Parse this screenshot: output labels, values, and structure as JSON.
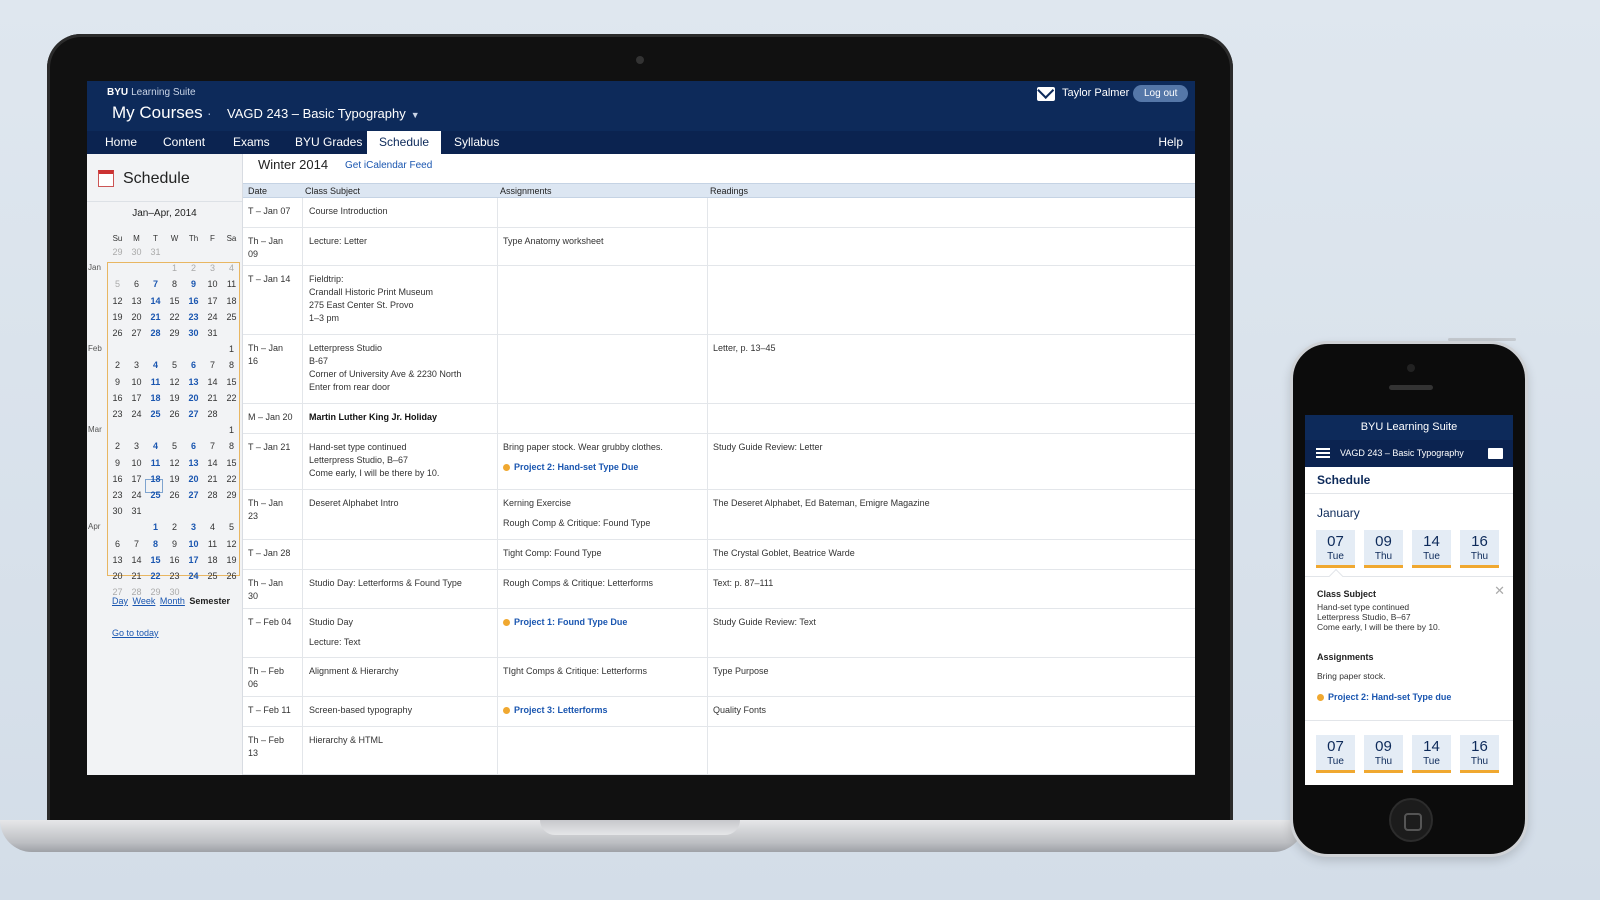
{
  "header": {
    "brand_bold": "BYU",
    "brand_rest": "Learning Suite",
    "my_courses": "My Courses",
    "separator": "·",
    "course": "VAGD 243 – Basic Typography",
    "user": "Taylor Palmer",
    "logout": "Log out"
  },
  "nav": {
    "tabs": [
      "Home",
      "Content",
      "Exams",
      "BYU Grades",
      "Schedule",
      "Syllabus"
    ],
    "active": "Schedule",
    "help": "Help"
  },
  "sidebar": {
    "title": "Schedule",
    "range": "Jan–Apr, 2014",
    "dow": [
      "Su",
      "M",
      "T",
      "W",
      "Th",
      "F",
      "Sa"
    ],
    "months": [
      "Jan",
      "Feb",
      "Mar",
      "Apr"
    ],
    "views": [
      "Day",
      "Week",
      "Month"
    ],
    "current_view": "Semester",
    "goto_today": "Go to today"
  },
  "main": {
    "term": "Winter 2014",
    "ical": "Get iCalendar Feed",
    "columns": [
      "Date",
      "Class Subject",
      "Assignments",
      "Readings"
    ],
    "rows": [
      {
        "date": "T – Jan 07",
        "subject": "Course Introduction",
        "assign": "",
        "project": "",
        "assign2": "",
        "reading": ""
      },
      {
        "date": "Th – Jan\n09",
        "subject": "Lecture: Letter",
        "assign": "Type Anatomy worksheet",
        "project": "",
        "assign2": "",
        "reading": ""
      },
      {
        "date": "T – Jan 14",
        "subject": "Fieldtrip:\nCrandall Historic Print Museum\n275 East Center St. Provo\n1–3 pm",
        "assign": "",
        "project": "",
        "assign2": "",
        "reading": ""
      },
      {
        "date": "Th – Jan\n16",
        "subject": "Letterpress Studio\nB-67\nCorner of University Ave & 2230 North\nEnter from rear door",
        "assign": "",
        "project": "",
        "assign2": "",
        "reading": "Letter, p. 13–45"
      },
      {
        "date": "M – Jan 20",
        "subject": "Martin Luther King Jr. Holiday",
        "assign": "",
        "project": "",
        "assign2": "",
        "reading": ""
      },
      {
        "date": "T – Jan 21",
        "subject": "Hand-set type continued\nLetterpress Studio, B–67\nCome early, I will be there by 10.",
        "assign": "Bring paper stock. Wear grubby clothes.",
        "project": "Project 2: Hand-set Type Due",
        "assign2": "",
        "reading": "Study Guide Review: Letter"
      },
      {
        "date": "Th – Jan\n23",
        "subject": "Deseret Alphabet Intro",
        "assign": "Kerning Exercise",
        "project": "",
        "assign2": "Rough Comp & Critique: Found Type",
        "reading": "The Deseret Alphabet, Ed Bateman, Emigre Magazine"
      },
      {
        "date": "T – Jan 28",
        "subject": "",
        "assign": "Tight Comp: Found Type",
        "project": "",
        "assign2": "",
        "reading": "The Crystal Goblet, Beatrice Warde"
      },
      {
        "date": "Th – Jan\n30",
        "subject": "Studio Day: Letterforms & Found Type",
        "assign": "Rough Comps & Critique: Letterforms",
        "project": "",
        "assign2": "",
        "reading": "Text: p. 87–111"
      },
      {
        "date": "T – Feb 04",
        "subject": "Studio Day",
        "subject2": "Lecture: Text",
        "assign": "",
        "project": "Project 1: Found Type Due",
        "assign2": "",
        "reading": "Study Guide Review: Text"
      },
      {
        "date": "Th – Feb\n06",
        "subject": "Alignment & Hierarchy",
        "assign": "TIght Comps & Critique: Letterforms",
        "project": "",
        "assign2": "",
        "reading": "Type Purpose"
      },
      {
        "date": "T – Feb 11",
        "subject": "Screen-based typography",
        "assign": "",
        "project": "Project 3: Letterforms",
        "assign2": "",
        "reading": "Quality Fonts"
      },
      {
        "date": "Th – Feb\n13",
        "subject": "Hierarchy & HTML",
        "assign": "",
        "project": "",
        "assign2": "",
        "reading": ""
      }
    ]
  },
  "phone": {
    "brand": "BYU Learning Suite",
    "course": "VAGD 243 – Basic Typography",
    "title": "Schedule",
    "month": "January",
    "days": [
      {
        "n": "07",
        "w": "Tue"
      },
      {
        "n": "09",
        "w": "Thu"
      },
      {
        "n": "14",
        "w": "Tue"
      },
      {
        "n": "16",
        "w": "Thu"
      }
    ],
    "detail": {
      "subject_label": "Class Subject",
      "subject_text": "Hand-set type continued\nLetterpress Studio, B–67\nCome early, I will be there by 10.",
      "assign_label": "Assignments",
      "assign_text": "Bring paper stock.",
      "project": "Project 2: Hand-set Type due"
    }
  },
  "colors": {
    "navy": "#0d2a5a",
    "link": "#1a56b0",
    "accent": "#f0a830"
  },
  "icons": [
    "mail-icon",
    "calendar-icon",
    "caret-down-icon",
    "hamburger-icon",
    "close-icon"
  ]
}
